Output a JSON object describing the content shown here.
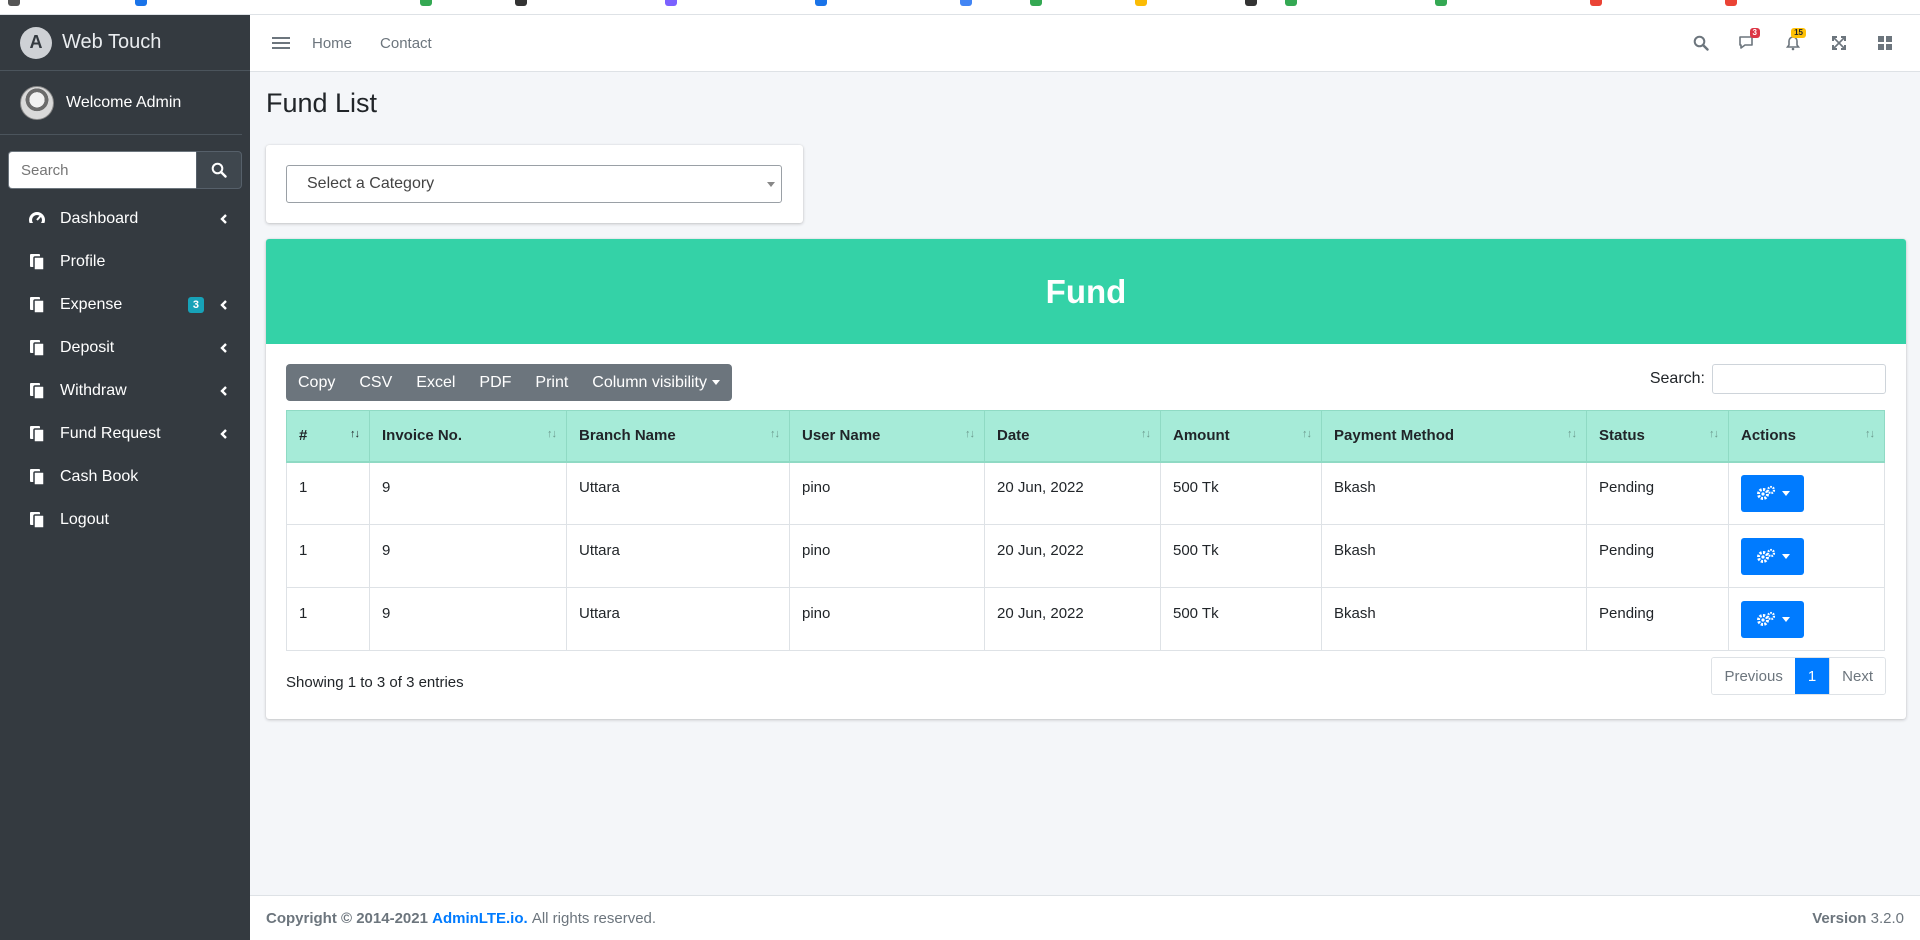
{
  "brand": {
    "name": "Web Touch",
    "logo_letter": "A"
  },
  "user": {
    "name": "Welcome Admin"
  },
  "sidebar": {
    "search_placeholder": "Search",
    "items": [
      {
        "label": "Dashboard",
        "icon": "dashboard-icon",
        "has_chevron": true
      },
      {
        "label": "Profile",
        "icon": "copy-icon",
        "has_chevron": false
      },
      {
        "label": "Expense",
        "icon": "copy-icon",
        "has_chevron": true,
        "badge": "3"
      },
      {
        "label": "Deposit",
        "icon": "copy-icon",
        "has_chevron": true
      },
      {
        "label": "Withdraw",
        "icon": "copy-icon",
        "has_chevron": true
      },
      {
        "label": "Fund Request",
        "icon": "copy-icon",
        "has_chevron": true
      },
      {
        "label": "Cash Book",
        "icon": "copy-icon",
        "has_chevron": false
      },
      {
        "label": "Logout",
        "icon": "copy-icon",
        "has_chevron": false
      }
    ]
  },
  "header": {
    "links": [
      "Home",
      "Contact"
    ],
    "messages_count": "3",
    "notifications_count": "15",
    "colors": {
      "danger": "#dc3545",
      "warning": "#ffc107"
    }
  },
  "page": {
    "title": "Fund List"
  },
  "filter": {
    "select_placeholder": "Select a Category"
  },
  "fund": {
    "title": "Fund",
    "header_color": "#34d2a7",
    "buttons": [
      "Copy",
      "CSV",
      "Excel",
      "PDF",
      "Print",
      "Column visibility"
    ],
    "search_label": "Search:",
    "columns": [
      "#",
      "Invoice No.",
      "Branch Name",
      "User Name",
      "Date",
      "Amount",
      "Payment Method",
      "Status",
      "Actions"
    ],
    "rows": [
      [
        "1",
        "9",
        "Uttara",
        "pino",
        "20 Jun, 2022",
        "500 Tk",
        "Bkash",
        "Pending"
      ],
      [
        "1",
        "9",
        "Uttara",
        "pino",
        "20 Jun, 2022",
        "500 Tk",
        "Bkash",
        "Pending"
      ],
      [
        "1",
        "9",
        "Uttara",
        "pino",
        "20 Jun, 2022",
        "500 Tk",
        "Bkash",
        "Pending"
      ]
    ],
    "info": "Showing 1 to 3 of 3 entries",
    "pager": {
      "previous": "Previous",
      "current": "1",
      "next": "Next"
    }
  },
  "footer": {
    "copyright": "Copyright © 2014-2021",
    "link": "AdminLTE.io.",
    "rights": "All rights reserved.",
    "version_label": "Version",
    "version": "3.2.0"
  }
}
